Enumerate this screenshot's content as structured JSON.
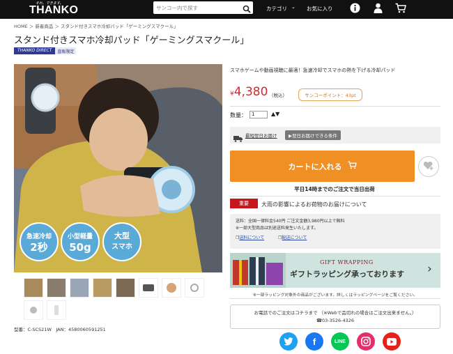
{
  "header": {
    "tagline": "それ、できます。",
    "logo": "THANKO",
    "search_placeholder": "サンコー内で探す",
    "category_label": "カテゴリ",
    "favorites_label": "お気に入り",
    "icons": [
      "search-icon",
      "chevron-down-icon",
      "info-icon",
      "user-icon",
      "cart-icon"
    ],
    "bg_color": "#111111"
  },
  "breadcrumb": "HOME ＞ 新着商品 ＞ スタンド付きスマホ冷却パッド「ゲーミングスマクール」",
  "product": {
    "title": "スタンド付きスマホ冷却パッド「ゲーミングスマクール」",
    "badge_brand": "THANKO DIRECT",
    "badge_note": "直販限定",
    "image_labels": [
      "急速冷却 2秒",
      "小型軽量 50g",
      "大型スマホ 対応"
    ],
    "model": "型番：C-SCS21W　JAN：4580060591251",
    "thumbnail_count": 10
  },
  "purchase": {
    "description": "スマホゲームや動画視聴に最適！急速冷却でスマホの熱を下げる冷却パッド",
    "currency": "¥",
    "price": "4,380",
    "tax_label": "（税込）",
    "points": "サンコーポイント：43pt",
    "qty_label": "数量：",
    "qty_value": "1",
    "shipping_label": "最短翌日お届け",
    "shipping_btn": "▶翌日お届けできる条件",
    "cart_label": "カートに入れる",
    "same_day": "平日14時までのご注文で当日出荷",
    "accent_color": "#f08f24",
    "price_color": "#d6262f"
  },
  "notice": {
    "badge": "重要",
    "text": "大雨の影響によるお荷物のお届けについて"
  },
  "info": {
    "line1": "送料：全国一律料金540円 ご注文金額3,980円以上で無料",
    "line2": "※一部大型商品は別途送料発生いたします。",
    "link1": "送料について",
    "link2": "配送について"
  },
  "gift": {
    "en": "GIFT WRAPPING",
    "jp": "ギフトラッピング承っております",
    "note": "※一部ラッピング対象外の商品がございます。詳しくはラッピングページをご覧ください。"
  },
  "phone": {
    "line1": "お電話でのご注文はコチラまで （※Webで品切れの場合はご注文出来ません。）",
    "line2": "☎03-3526-4326"
  },
  "social": [
    "twitter-icon",
    "facebook-icon",
    "line-icon",
    "instagram-icon",
    "youtube-icon"
  ]
}
